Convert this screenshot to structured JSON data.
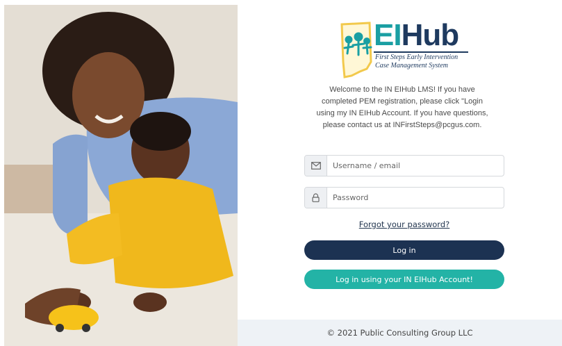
{
  "photo": {
    "description_icon": "mother-and-baby-photo"
  },
  "logo": {
    "title_ei": "EI",
    "title_hub": "Hub",
    "subtitle": "First Steps Early Intervention Case Management System",
    "icon": "indiana-state-outline-icon"
  },
  "welcome_text": "Welcome to the IN EIHub LMS! If you have completed PEM registration, please click \"Login using my IN EIHub Account. If you have questions, please contact us at INFirstSteps@pcgus.com.",
  "form": {
    "username_placeholder": "Username / email",
    "password_placeholder": "Password",
    "username_icon": "envelope-icon",
    "password_icon": "lock-icon",
    "forgot_label": "Forgot your password?",
    "login_label": "Log in",
    "eihub_login_label": "Log in using your IN EIHub Account!"
  },
  "footer": {
    "copyright": "© 2021 Public Consulting Group LLC"
  },
  "colors": {
    "navy": "#1c3252",
    "teal": "#23b3a6",
    "logo_teal": "#1a9fa3",
    "logo_yellow": "#f2c94c"
  }
}
